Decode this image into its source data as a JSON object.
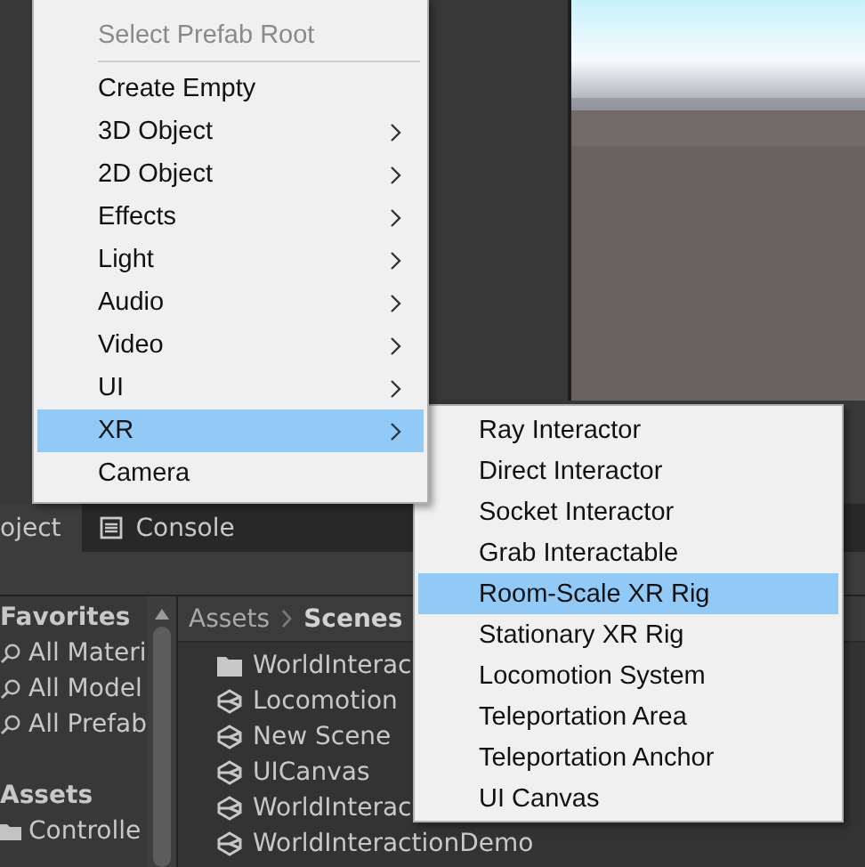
{
  "context_menu": {
    "items": [
      {
        "kind": "item",
        "label": "Select Prefab Root",
        "disabled": true,
        "submenu": false,
        "selected": false
      },
      {
        "kind": "separator"
      },
      {
        "kind": "item",
        "label": "Create Empty",
        "disabled": false,
        "submenu": false,
        "selected": false
      },
      {
        "kind": "item",
        "label": "3D Object",
        "disabled": false,
        "submenu": true,
        "selected": false
      },
      {
        "kind": "item",
        "label": "2D Object",
        "disabled": false,
        "submenu": true,
        "selected": false
      },
      {
        "kind": "item",
        "label": "Effects",
        "disabled": false,
        "submenu": true,
        "selected": false
      },
      {
        "kind": "item",
        "label": "Light",
        "disabled": false,
        "submenu": true,
        "selected": false
      },
      {
        "kind": "item",
        "label": "Audio",
        "disabled": false,
        "submenu": true,
        "selected": false
      },
      {
        "kind": "item",
        "label": "Video",
        "disabled": false,
        "submenu": true,
        "selected": false
      },
      {
        "kind": "item",
        "label": "UI",
        "disabled": false,
        "submenu": true,
        "selected": false
      },
      {
        "kind": "item",
        "label": "XR",
        "disabled": false,
        "submenu": true,
        "selected": true
      },
      {
        "kind": "item",
        "label": "Camera",
        "disabled": false,
        "submenu": false,
        "selected": false
      }
    ]
  },
  "submenu": {
    "items": [
      {
        "label": "Ray Interactor",
        "selected": false
      },
      {
        "label": "Direct Interactor",
        "selected": false
      },
      {
        "label": "Socket Interactor",
        "selected": false
      },
      {
        "label": "Grab Interactable",
        "selected": false
      },
      {
        "label": "Room-Scale XR Rig",
        "selected": true
      },
      {
        "label": "Stationary XR Rig",
        "selected": false
      },
      {
        "label": "Locomotion System",
        "selected": false
      },
      {
        "label": "Teleportation Area",
        "selected": false
      },
      {
        "label": "Teleportation Anchor",
        "selected": false
      },
      {
        "label": "UI Canvas",
        "selected": false
      }
    ]
  },
  "panel_tabs": [
    {
      "label": "oject",
      "selected": true,
      "kind": "plain"
    },
    {
      "label": "Console",
      "selected": false,
      "kind": "console"
    }
  ],
  "favorites": {
    "heading": "Favorites",
    "items": [
      "All Materi",
      "All Model",
      "All Prefab"
    ]
  },
  "assets": {
    "heading": "Assets",
    "items": [
      "Controlle"
    ]
  },
  "breadcrumb": [
    {
      "label": "Assets",
      "current": false
    },
    {
      "label": "Scenes",
      "current": true
    }
  ],
  "files": [
    {
      "name": "WorldInterac",
      "kind": "folder"
    },
    {
      "name": "Locomotion",
      "kind": "scene"
    },
    {
      "name": "New Scene",
      "kind": "scene"
    },
    {
      "name": "UICanvas",
      "kind": "scene"
    },
    {
      "name": "WorldInterac",
      "kind": "scene"
    },
    {
      "name": "WorldInteractionDemo",
      "kind": "scene"
    }
  ]
}
